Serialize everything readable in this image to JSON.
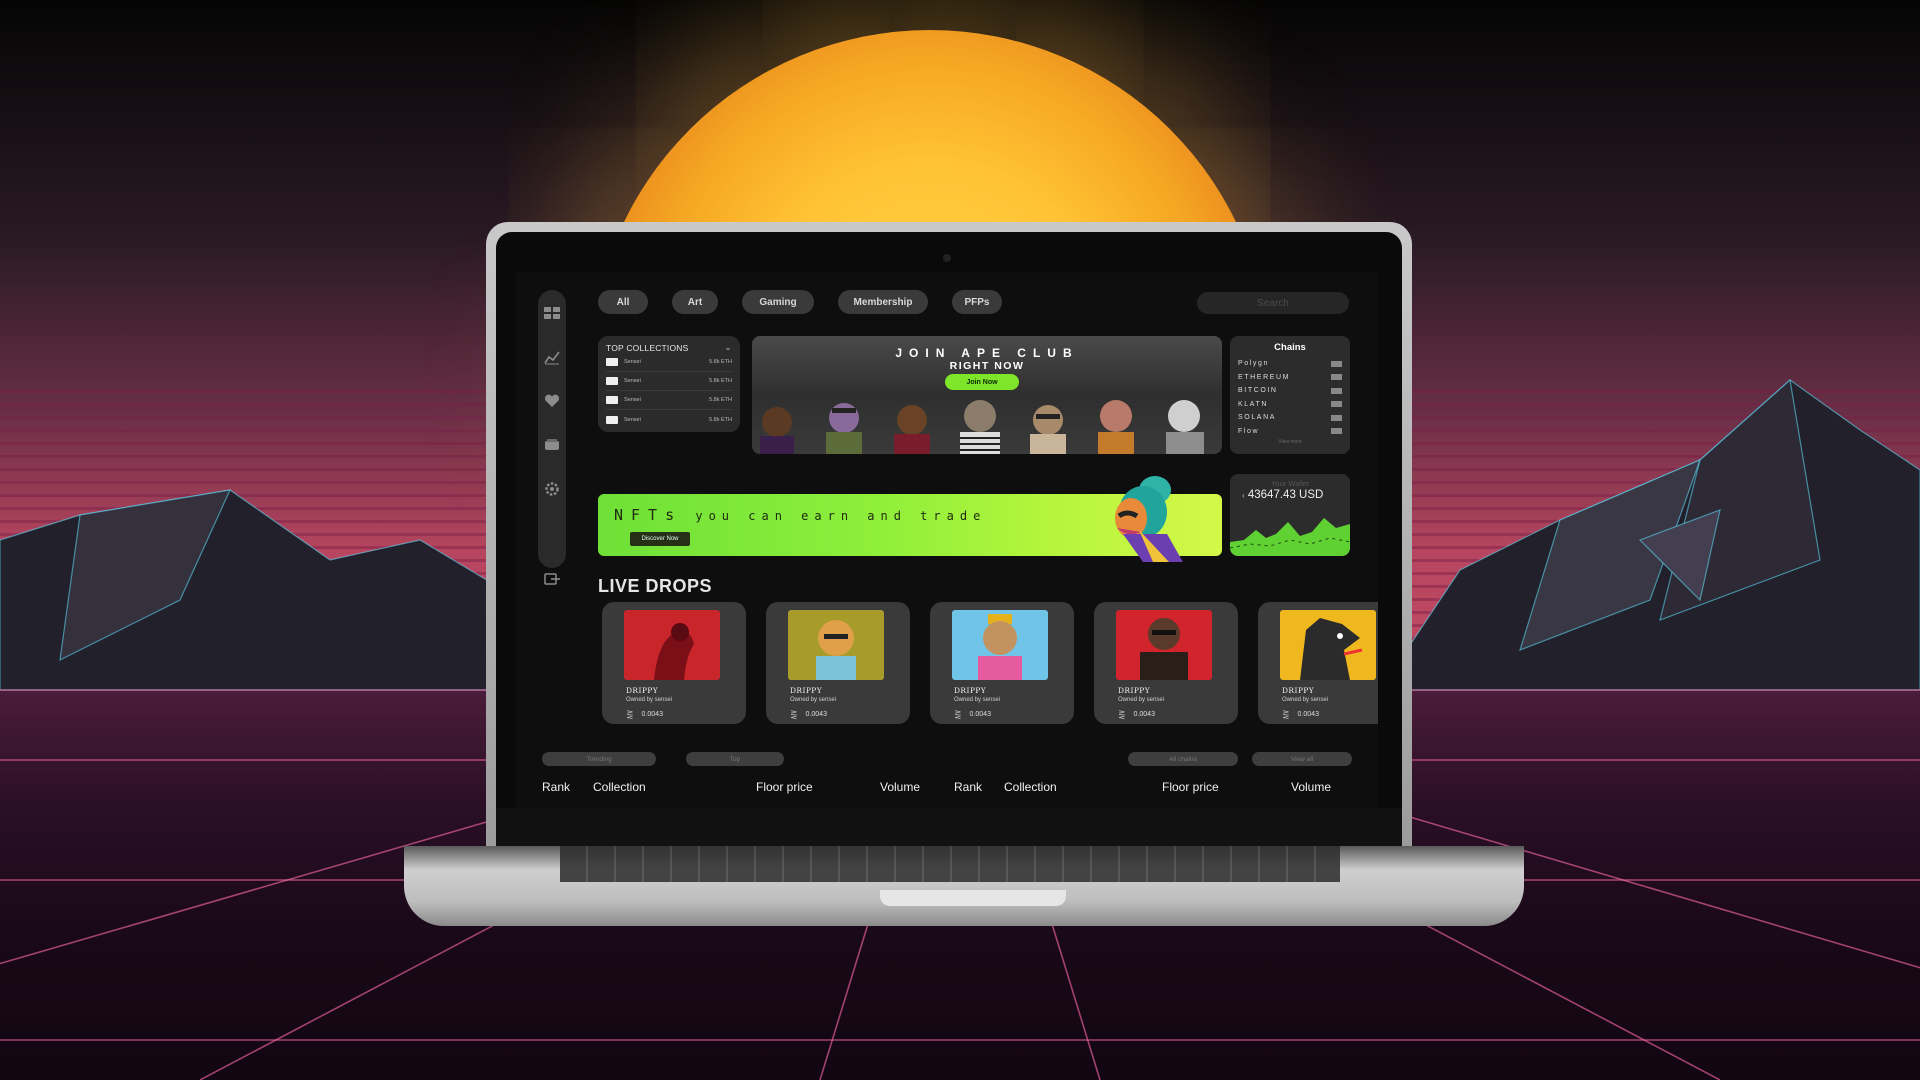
{
  "app": {
    "nav_icons": [
      "dashboard-icon",
      "chart-line-icon",
      "heart-icon",
      "wallet-icon",
      "settings-icon",
      "logout-icon"
    ],
    "tabs": [
      "All",
      "Art",
      "Gaming",
      "Membership",
      "PFPs"
    ],
    "search": {
      "placeholder": "Search"
    },
    "top_collections": {
      "title": "TOP COLLECTIONS",
      "rows": [
        {
          "name": "Sensei",
          "value": "5.8k ETH"
        },
        {
          "name": "Sensei",
          "value": "5.8k ETH"
        },
        {
          "name": "Sensei",
          "value": "5.8k ETH"
        },
        {
          "name": "Sensei",
          "value": "5.8k ETH"
        }
      ]
    },
    "hero": {
      "title": "JOIN APE CLUB",
      "subtitle": "RIGHT NOW",
      "button": "Join Now"
    },
    "chains": {
      "title": "Chains",
      "items": [
        "Polygn",
        "ETHEREUM",
        "BITCOIN",
        "KLATN",
        "SOLANA",
        "Flow"
      ],
      "view_more": "View more"
    },
    "banner": {
      "big": "NFTs",
      "text": "you can earn and trade",
      "button": "Discover Now"
    },
    "wallet": {
      "label": "Your Wallet",
      "value": "43647.43 USD"
    },
    "live_drops": {
      "title": "LIVE DROPS",
      "cards": [
        {
          "name": "DRIPPY",
          "owner": "Owned by sensei",
          "price": "0.0043",
          "bg": "#c8262b"
        },
        {
          "name": "DRIPPY",
          "owner": "Owned by sensei",
          "price": "0.0043",
          "bg": "#a79b2a"
        },
        {
          "name": "DRIPPY",
          "owner": "Owned by sensei",
          "price": "0.0043",
          "bg": "#6fc4e8"
        },
        {
          "name": "DRIPPY",
          "owner": "Owned by sensei",
          "price": "0.0043",
          "bg": "#d1242d"
        },
        {
          "name": "DRIPPY",
          "owner": "Owned by sensei",
          "price": "0.0043",
          "bg": "#f0b81f"
        }
      ]
    },
    "filters": {
      "trending": "Trending",
      "top": "Top",
      "all_chains": "All chains",
      "view_all": "View all"
    },
    "table": {
      "left": {
        "rank": "Rank",
        "collection": "Collection",
        "floor": "Floor price",
        "volume": "Volume"
      },
      "right": {
        "rank": "Rank",
        "collection": "Collection",
        "floor": "Floor price",
        "volume": "Volume"
      }
    },
    "colors": {
      "accent": "#7fe52b",
      "panel": "#2c2c2c",
      "background": "#0e0e0e"
    }
  }
}
